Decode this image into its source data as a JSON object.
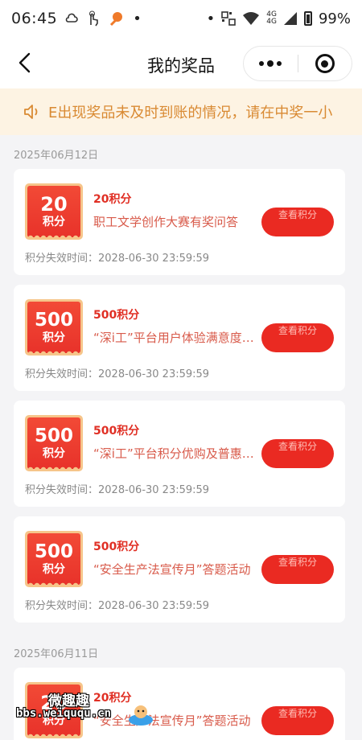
{
  "status_bar": {
    "time": "06:45",
    "battery_percent": "99%",
    "network_top": "4G",
    "network_bottom": "4G"
  },
  "nav": {
    "title": "我的奖品",
    "icons": [
      "back-arrow-icon",
      "more-dots-icon",
      "close-target-icon"
    ]
  },
  "notice": {
    "icon": "speaker-icon",
    "text": "E出现奖品未及时到账的情况，请在中奖一小"
  },
  "groups": [
    {
      "date": "2025年06月12日",
      "cards": [
        {
          "badge_value": "20",
          "badge_unit": "积分",
          "title": "20积分",
          "desc": "职工文学创作大赛有奖问答",
          "expire": "积分失效时间：2028-06-30 23:59:59",
          "button": "查看积分"
        },
        {
          "badge_value": "500",
          "badge_unit": "积分",
          "title": "500积分",
          "desc": "“深i工”平台用户体验满意度调查",
          "expire": "积分失效时间：2028-06-30 23:59:59",
          "button": "查看积分"
        },
        {
          "badge_value": "500",
          "badge_unit": "积分",
          "title": "500积分",
          "desc": "“深i工”平台积分优购及普惠商城",
          "expire": "积分失效时间：2028-06-30 23:59:59",
          "button": "查看积分"
        },
        {
          "badge_value": "500",
          "badge_unit": "积分",
          "title": "500积分",
          "desc": "“安全生产法宣传月”答题活动",
          "expire": "积分失效时间：2028-06-30 23:59:59",
          "button": "查看积分"
        }
      ]
    },
    {
      "date": "2025年06月11日",
      "cards": [
        {
          "badge_value": "20",
          "badge_unit": "积分",
          "title": "20积分",
          "desc": "“安全生产法宣传月”答题活动",
          "button": "查看积分"
        }
      ]
    }
  ],
  "watermark": {
    "cn": "微趣趣",
    "en": "bbs.weiququ.cn"
  },
  "colors": {
    "accent_red": "#ea2a22",
    "badge_gold": "#f6c58a",
    "notice_bg": "#fdf3e3",
    "notice_text": "#d98a33"
  }
}
